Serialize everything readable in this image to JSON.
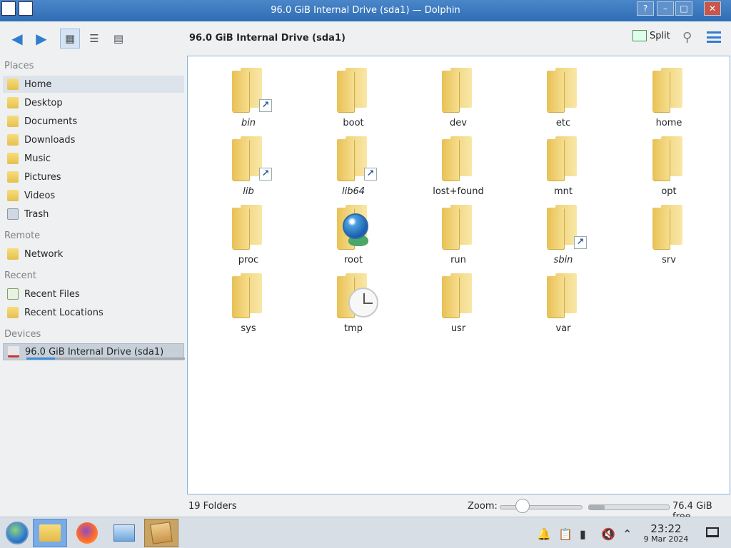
{
  "window": {
    "title": "96.0 GiB Internal Drive (sda1) — Dolphin"
  },
  "toolbar": {
    "location": "96.0 GiB Internal Drive (sda1)",
    "split_label": "Split"
  },
  "sidebar": {
    "sections": {
      "places": "Places",
      "remote": "Remote",
      "recent": "Recent",
      "devices": "Devices"
    },
    "places": [
      "Home",
      "Desktop",
      "Documents",
      "Downloads",
      "Music",
      "Pictures",
      "Videos",
      "Trash"
    ],
    "remote": [
      "Network"
    ],
    "recent": [
      "Recent Files",
      "Recent Locations"
    ],
    "devices": [
      "96.0 GiB Internal Drive (sda1)"
    ],
    "device_usage_fraction": 0.18
  },
  "folders": [
    {
      "name": "bin",
      "symlink": true
    },
    {
      "name": "boot",
      "symlink": false
    },
    {
      "name": "dev",
      "symlink": false
    },
    {
      "name": "etc",
      "symlink": false
    },
    {
      "name": "home",
      "symlink": false
    },
    {
      "name": "lib",
      "symlink": true
    },
    {
      "name": "lib64",
      "symlink": true
    },
    {
      "name": "lost+found",
      "symlink": false
    },
    {
      "name": "mnt",
      "symlink": false
    },
    {
      "name": "opt",
      "symlink": false
    },
    {
      "name": "proc",
      "symlink": false
    },
    {
      "name": "root",
      "symlink": false
    },
    {
      "name": "run",
      "symlink": false
    },
    {
      "name": "sbin",
      "symlink": true
    },
    {
      "name": "srv",
      "symlink": false
    },
    {
      "name": "sys",
      "symlink": false
    },
    {
      "name": "tmp",
      "symlink": false
    },
    {
      "name": "usr",
      "symlink": false
    },
    {
      "name": "var",
      "symlink": false
    }
  ],
  "statusbar": {
    "count": "19 Folders",
    "zoom_label": "Zoom:",
    "zoom_fraction": 0.28,
    "free_space": "76.4 GiB free",
    "used_fraction": 0.2
  },
  "taskbar": {
    "time": "23:22",
    "date": "9 Mar 2024"
  },
  "colors": {
    "accent": "#2f7cd1",
    "titlebar": "#3b79c0",
    "folder": "#f0cf6a"
  },
  "icons": {
    "back": "arrow-left-icon",
    "forward": "arrow-right-icon",
    "icons_view": "icons-view-icon",
    "compact_view": "compact-view-icon",
    "details_view": "details-view-icon",
    "split": "split-view-icon",
    "search": "search-icon",
    "menu": "hamburger-menu-icon"
  }
}
